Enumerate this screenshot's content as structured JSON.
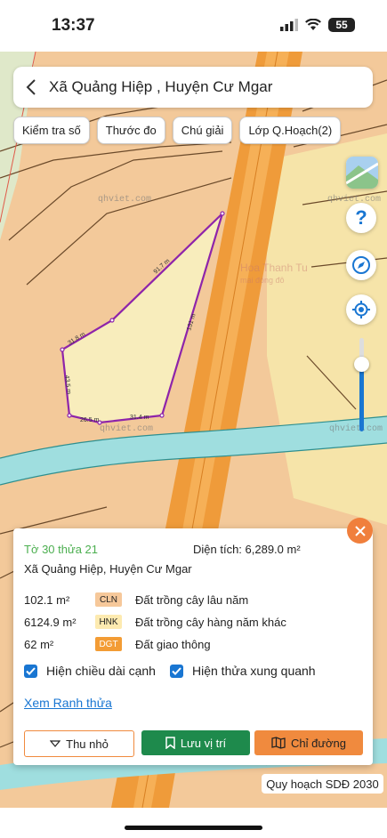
{
  "status": {
    "time": "13:37",
    "battery": "55"
  },
  "header": {
    "title": "Xã Quảng Hiệp , Huyện Cư Mgar"
  },
  "toolbar": {
    "chips": [
      "Kiểm tra số",
      "Thước đo",
      "Chú giải",
      "Lớp Q.Hoạch(2)"
    ]
  },
  "map": {
    "watermarks": [
      "qhviet.com",
      "qhviet.com",
      "qhviet.com",
      "qhviet.com",
      "Hoa Thanh Tu",
      "mai đóng đô"
    ],
    "edge_lengths": [
      "91.7 m",
      "31.8 m",
      "43.5 m",
      "26.5 m",
      "31.4 m",
      "131 m"
    ],
    "parcel_color": "#8e24aa",
    "zoom_level": 0.72
  },
  "parcel": {
    "id": "Tờ 30 thửa 21",
    "area_label": "Diện tích: 6,289.0 m²",
    "location": "Xã Quảng Hiệp, Huyện Cư Mgar",
    "land_uses": [
      {
        "area": "102.1 m²",
        "code": "CLN",
        "name": "Đất trồng cây lâu năm",
        "color": "#f6c89a"
      },
      {
        "area": "6124.9 m²",
        "code": "HNK",
        "name": "Đất trồng cây hàng năm khác",
        "color": "#fdeab0"
      },
      {
        "area": "62 m²",
        "code": "DGT",
        "name": "Đất giao thông",
        "color": "#f39c35"
      }
    ],
    "show_edge_lengths": "Hiện chiều dài cạnh",
    "show_neighbors": "Hiện thửa xung quanh",
    "view_boundary": "Xem Ranh thửa"
  },
  "actions": {
    "collapse": "Thu nhỏ",
    "save": "Lưu vị trí",
    "directions": "Chỉ đường"
  },
  "footer": {
    "plan_label": "Quy hoạch SDĐ 2030"
  },
  "colors": {
    "accent": "#1976d2",
    "orange": "#f08a3e",
    "green": "#1e8a4c"
  }
}
